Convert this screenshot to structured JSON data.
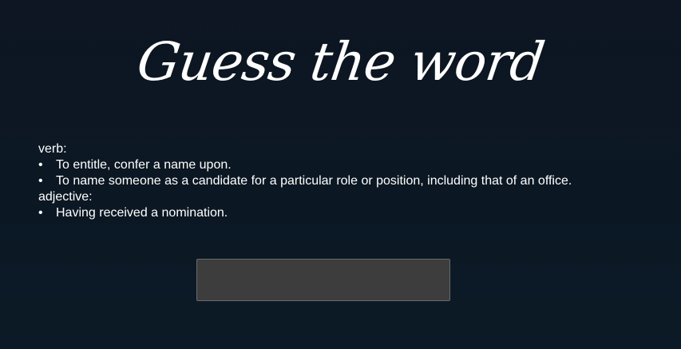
{
  "header": {
    "title": "Guess the word"
  },
  "definitions": [
    {
      "part_of_speech": "verb:",
      "senses": [
        "To entitle, confer a name upon.",
        "To name someone as a candidate for a particular role or position, including that of an office."
      ]
    },
    {
      "part_of_speech": "adjective:",
      "senses": [
        "Having received a nomination."
      ]
    }
  ],
  "guess_input": {
    "value": "",
    "placeholder": ""
  },
  "bullet_glyph": "•",
  "colors": {
    "background": "#0b1824",
    "text": "#ffffff",
    "input_background": "#3d3d3d",
    "input_border": "#6a6a6a"
  }
}
